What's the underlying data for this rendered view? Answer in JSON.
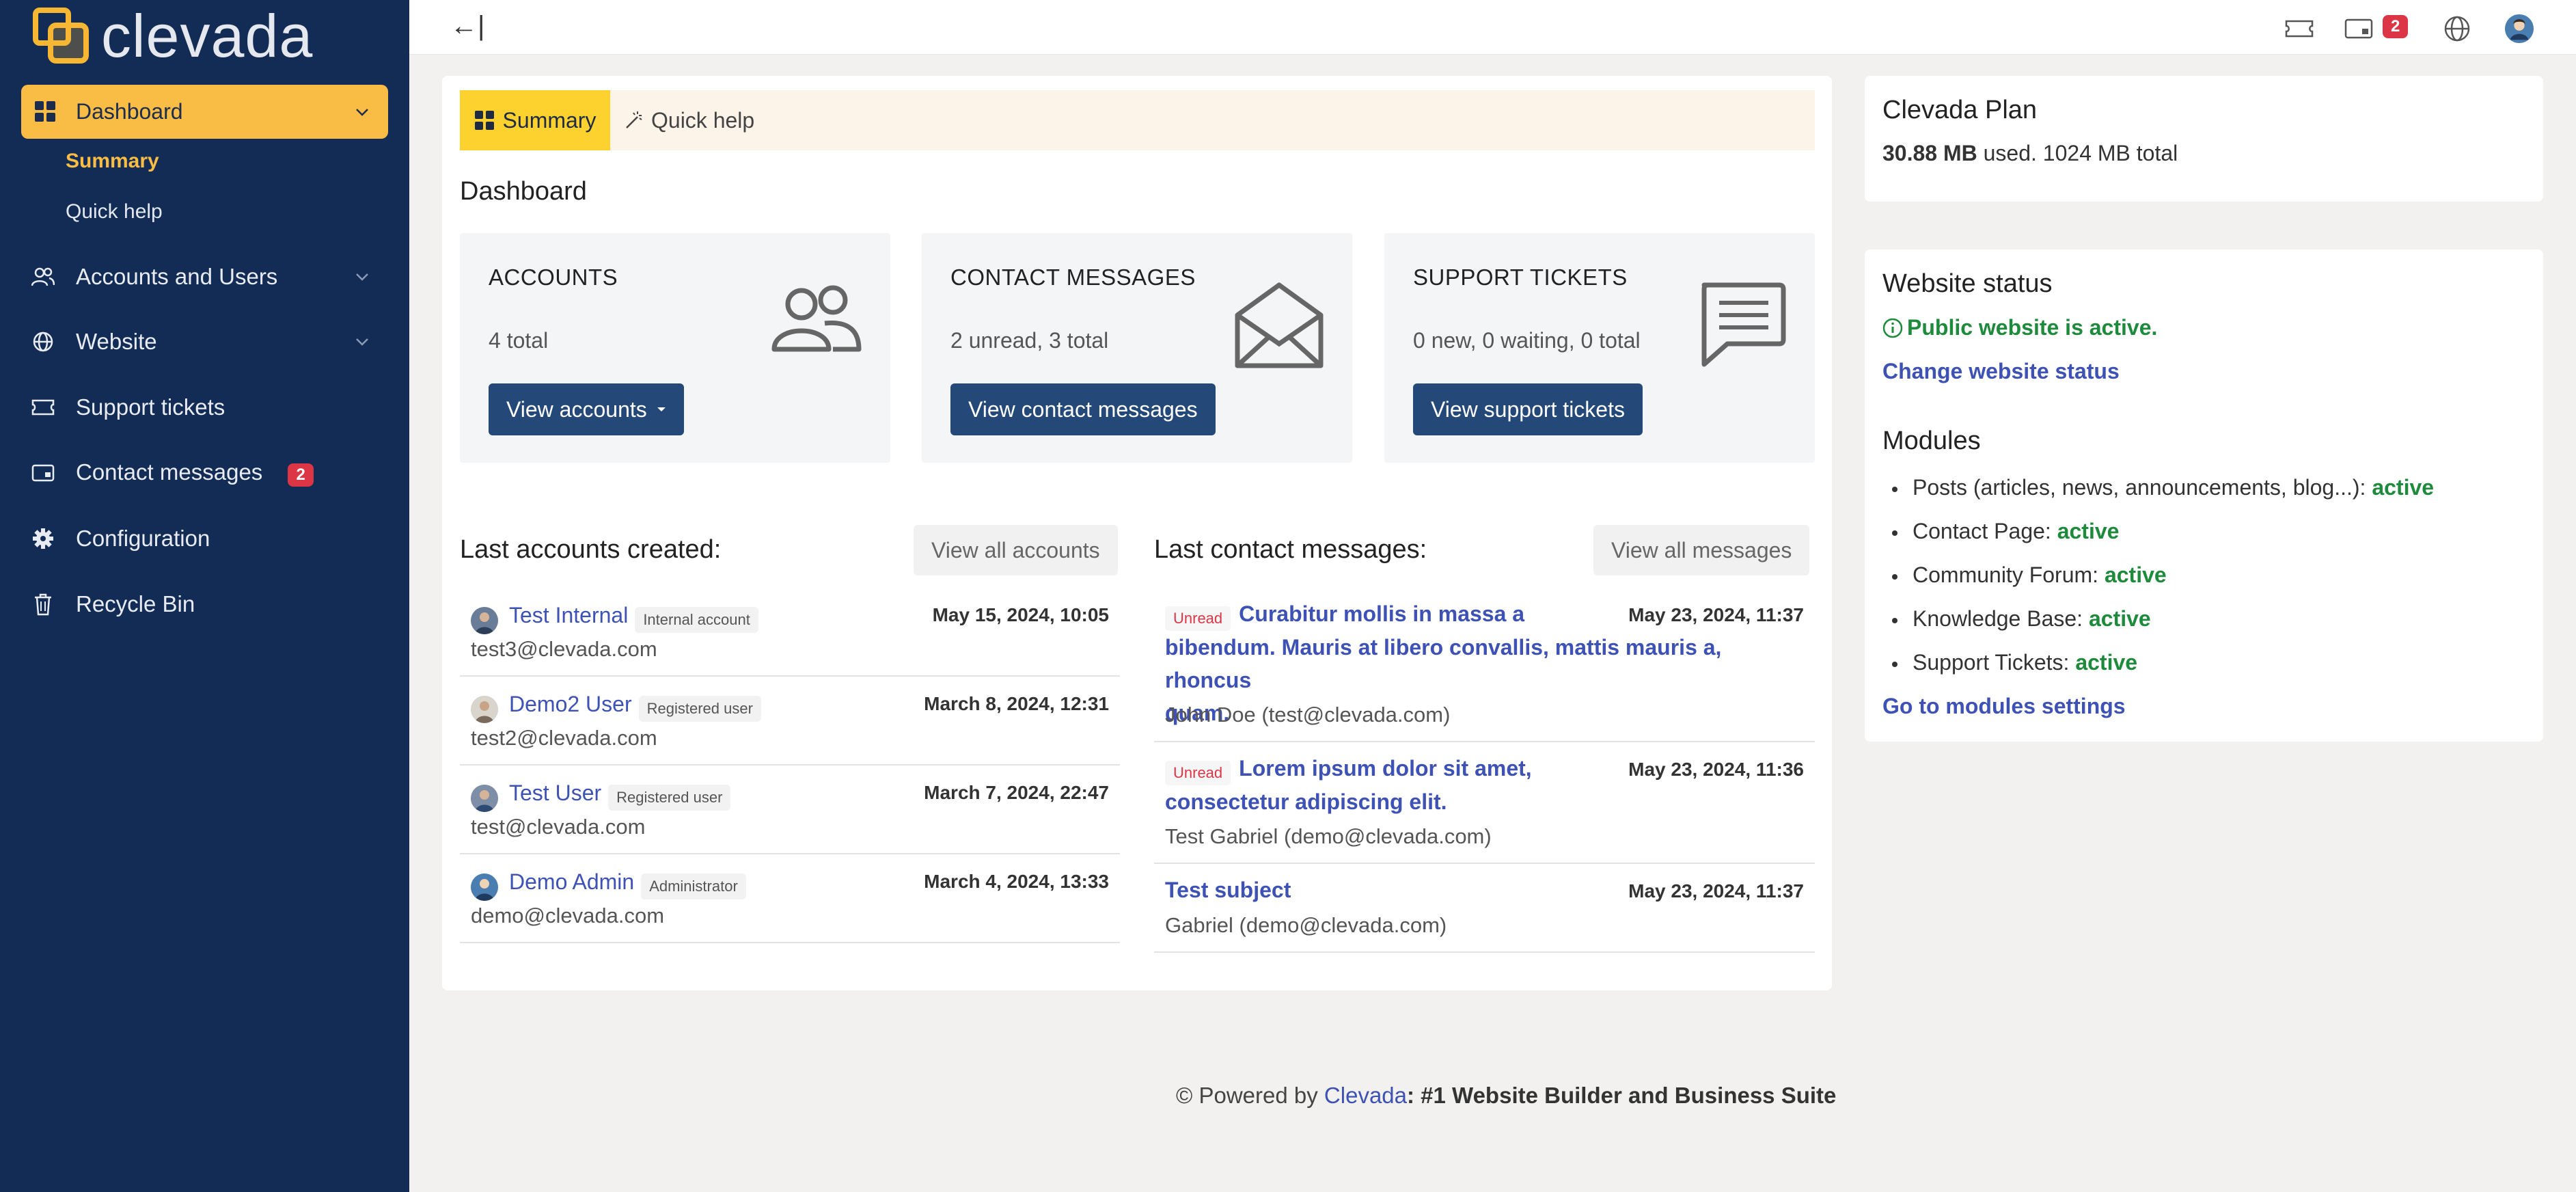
{
  "brand": {
    "name": "clevada",
    "accent": "#f9bd45",
    "sidebar_bg": "#132c55"
  },
  "sidebar": {
    "dashboard": "Dashboard",
    "sub_items": [
      "Summary",
      "Quick help"
    ],
    "items": [
      {
        "label": "Accounts and Users",
        "icon": "users-icon",
        "has_chevron": true
      },
      {
        "label": "Website",
        "icon": "globe-icon",
        "has_chevron": true
      },
      {
        "label": "Support tickets",
        "icon": "ticket-icon",
        "has_chevron": false
      },
      {
        "label": "Contact messages",
        "icon": "message-icon",
        "badge": "2"
      },
      {
        "label": "Configuration",
        "icon": "gear-icon"
      },
      {
        "label": "Recycle Bin",
        "icon": "trash-icon"
      }
    ]
  },
  "topbar": {
    "collapse": "←|",
    "messages_badge": "2"
  },
  "tabs": {
    "summary": "Summary",
    "quick_help": "Quick help"
  },
  "dashboard_title": "Dashboard",
  "stats": [
    {
      "title": "ACCOUNTS",
      "count": "4 total",
      "button": "View accounts"
    },
    {
      "title": "CONTACT MESSAGES",
      "count": "2 unread, 3 total",
      "button": "View contact messages"
    },
    {
      "title": "SUPPORT TICKETS",
      "count": "0 new, 0 waiting, 0 total",
      "button": "View support tickets"
    }
  ],
  "accounts": {
    "title": "Last accounts created:",
    "view_all": "View all accounts",
    "rows": [
      {
        "name": "Test Internal",
        "role": "Internal account",
        "email": "test3@clevada.com",
        "date": "May 15, 2024, 10:05"
      },
      {
        "name": "Demo2 User",
        "role": "Registered user",
        "email": "test2@clevada.com",
        "date": "March 8, 2024, 12:31"
      },
      {
        "name": "Test User",
        "role": "Registered user",
        "email": "test@clevada.com",
        "date": "March 7, 2024, 22:47"
      },
      {
        "name": "Demo Admin",
        "role": "Administrator",
        "email": "demo@clevada.com",
        "date": "March 4, 2024, 13:33"
      }
    ]
  },
  "messages": {
    "title": "Last contact messages:",
    "view_all": "View all messages",
    "unread_label": "Unread",
    "rows": [
      {
        "subject_l1": "Curabitur mollis in massa a",
        "subject_l2": "bibendum. Mauris at libero convallis, mattis mauris a, rhoncus",
        "subject_l3": "quam.",
        "from": "John Doe (test@clevada.com)",
        "date": "May 23, 2024, 11:37"
      },
      {
        "subject_l1": "Lorem ipsum dolor sit amet,",
        "subject_l2": "consectetur adipiscing elit.",
        "from": "Test Gabriel (demo@clevada.com)",
        "date": "May 23, 2024, 11:36"
      },
      {
        "subject_l1": "Test subject",
        "from": "Gabriel (demo@clevada.com)",
        "date": "May 23, 2024, 11:37"
      }
    ]
  },
  "plan": {
    "title": "Clevada Plan",
    "used": "30.88 MB",
    "rest": "used. 1024 MB total"
  },
  "website_status": {
    "title": "Website status",
    "status": "Public website is active.",
    "change_link": "Change website status",
    "modules_title": "Modules",
    "modules": [
      {
        "name": "Posts (articles, news, announcements, blog...):",
        "state": "active"
      },
      {
        "name": "Contact Page:",
        "state": "active"
      },
      {
        "name": "Community Forum:",
        "state": "active"
      },
      {
        "name": "Knowledge Base:",
        "state": "active"
      },
      {
        "name": "Support Tickets:",
        "state": "active"
      }
    ],
    "modules_link": "Go to modules settings"
  },
  "footer": {
    "prefix": "© Powered by",
    "brand": "Clevada",
    "suffix": ": #1 Website Builder and Business Suite"
  }
}
